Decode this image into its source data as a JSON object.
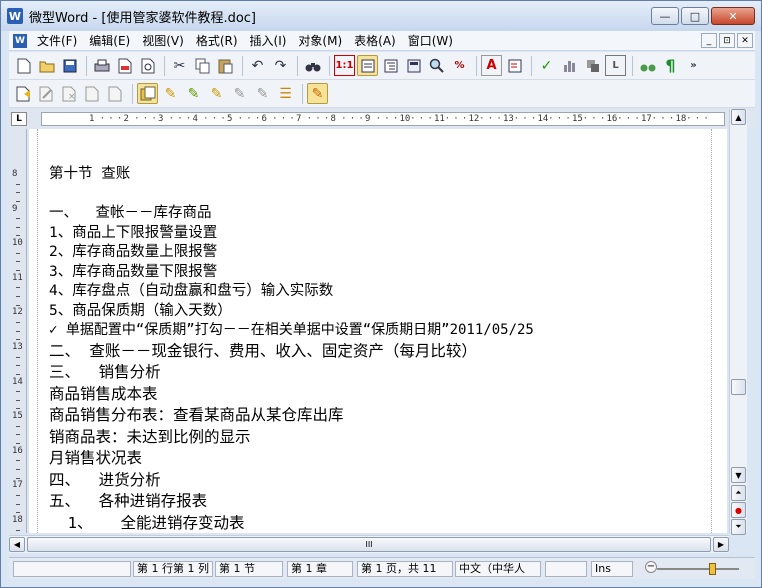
{
  "window": {
    "title": "微型Word - [使用管家婆软件教程.doc]",
    "app_icon": "W",
    "buttons": [
      "—",
      "□",
      "✕"
    ]
  },
  "menu": [
    "文件(F)",
    "编辑(E)",
    "视图(V)",
    "格式(R)",
    "插入(I)",
    "对象(M)",
    "表格(A)",
    "窗口(W)"
  ],
  "menu_logo": "W",
  "doc_ctrls": [
    "_",
    "⊡",
    "✕"
  ],
  "ruler": {
    "corner": "L",
    "numbers": [
      "1",
      "2",
      "3",
      "4",
      "5",
      "6",
      "7",
      "8",
      "9",
      "10",
      "11",
      "12",
      "13",
      "14",
      "15",
      "16",
      "17",
      "18"
    ],
    "vertical": [
      "8",
      "9",
      "10",
      "11",
      "12",
      "13",
      "14",
      "15",
      "16",
      "17",
      "18"
    ]
  },
  "document": {
    "lines": [
      "第十节 查账",
      "",
      "一、  查帐－－库存商品",
      "1、商品上下限报警量设置",
      "2、库存商品数量上限报警",
      "3、库存商品数量下限报警",
      "4、库存盘点（自动盘赢和盘亏）输入实际数",
      "5、商品保质期（输入天数）",
      "✓ 单据配置中“保质期”打勾－－在相关单据中设置“保质期日期”2011/05/25",
      "二、 查账－－现金银行、费用、收入、固定资产（每月比较）",
      "三、  销售分析",
      "商品销售成本表",
      "商品销售分布表：查看某商品从某仓库出库",
      "销商品表：未达到比例的显示",
      "月销售状况表",
      "四、  进货分析",
      "五、  各种进销存报表",
      "  1、   全能进销存变动表"
    ]
  },
  "toolbar1": {
    "icons": [
      "new-doc-icon",
      "open-folder-icon",
      "save-icon",
      "print-icon",
      "pdf-icon",
      "print-preview-icon",
      "cut-icon",
      "copy-icon",
      "paste-icon",
      "undo-icon",
      "redo-icon",
      "find-icon",
      "page-view-icon",
      "normal-view-icon",
      "outline-view-icon",
      "layout-view-icon",
      "zoom-icon",
      "percent-icon",
      "font-color-icon",
      "text-box-icon",
      "spellcheck-icon",
      "chart-icon",
      "shape-icon",
      "frame-icon",
      "binoculars-icon",
      "paragraph-mark-icon"
    ],
    "labels": {
      "page_view": "1:1",
      "percent": "%",
      "font_color": "A",
      "frame": "L",
      "paragraph": "¶",
      "more": "»"
    }
  },
  "toolbar2": {
    "icons": [
      "insert-comment-icon",
      "edit-comment-icon",
      "delete-comment-icon",
      "prev-comment-icon",
      "next-comment-icon",
      "track-changes-icon",
      "accept-change-icon",
      "reject-change-icon",
      "accept-all-icon",
      "reject-all-icon",
      "prev-change-icon",
      "review-pane-icon"
    ]
  },
  "scrollbar": {
    "up": "▲",
    "down": "▼",
    "left": "◀",
    "right": "▶",
    "grip": "III",
    "prev_page": "⏶",
    "browse_object": "●",
    "next_page": "⏷"
  },
  "status": {
    "row_col": "第 1 行第 1 列",
    "section": "第 1 节",
    "chapter": "第 1 章",
    "page": "第 1 页，共 11",
    "language": "中文（中华人",
    "mode": "Ins",
    "zoom_minus": "−"
  }
}
